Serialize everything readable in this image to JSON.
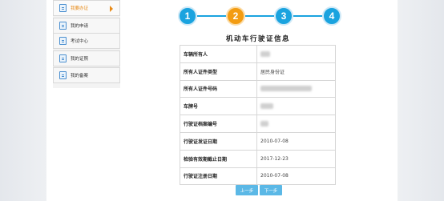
{
  "sidebar": {
    "items": [
      {
        "label": "我要办证"
      },
      {
        "label": "我的申请"
      },
      {
        "label": "考试中心"
      },
      {
        "label": "我的证照"
      },
      {
        "label": "我的备案"
      }
    ]
  },
  "steps": [
    "1",
    "2",
    "3",
    "4"
  ],
  "current_step": 2,
  "form": {
    "title": "机动车行驶证信息",
    "rows": [
      {
        "label": "车辆所有人",
        "value": ""
      },
      {
        "label": "所有人证件类型",
        "value": "居民身份证"
      },
      {
        "label": "所有人证件号码",
        "value": ""
      },
      {
        "label": "车牌号",
        "value": ""
      },
      {
        "label": "行驶证档案编号",
        "value": ""
      },
      {
        "label": "行驶证发证日期",
        "value": "2010-07-08"
      },
      {
        "label": "检验有效期截止日期",
        "value": "2017-12-23"
      },
      {
        "label": "行驶证注册日期",
        "value": "2010-07-08"
      }
    ]
  },
  "buttons": {
    "prev": "上一步",
    "next": "下一步"
  },
  "colors": {
    "accent": "#1aa3df",
    "current_step": "#f39c12",
    "button": "#5bb8e6"
  }
}
